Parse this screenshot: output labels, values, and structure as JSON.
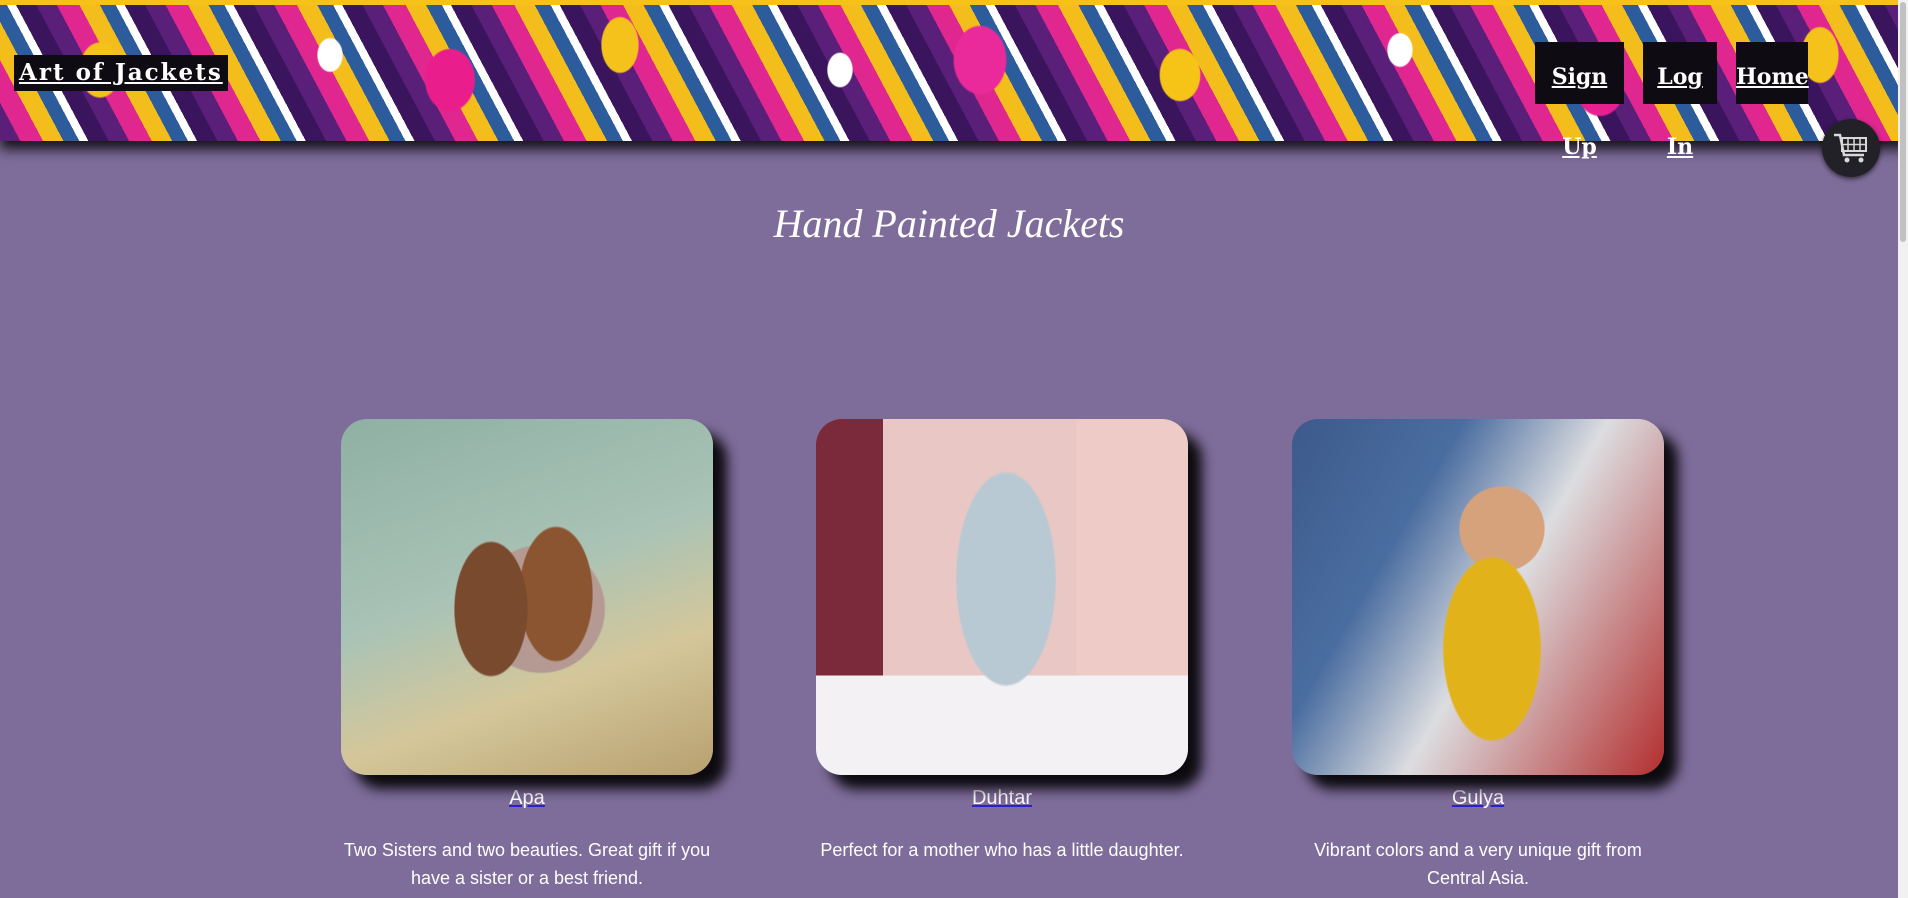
{
  "header": {
    "brand": "Art of Jackets",
    "nav": [
      {
        "label": "Sign Up"
      },
      {
        "label": "Log In"
      },
      {
        "label": "Home"
      }
    ],
    "cart_icon": "shopping-cart-icon"
  },
  "main": {
    "title": "Hand Painted Jackets",
    "products": [
      {
        "name": "Apa",
        "description": "Two Sisters and two beauties. Great gift if you have a sister or a best friend."
      },
      {
        "name": "Duhtar",
        "description": "Perfect for a mother who has a little daughter."
      },
      {
        "name": "Gulya",
        "description": "Vibrant colors and a very unique gift from Central Asia."
      }
    ]
  },
  "colors": {
    "background": "#7e6c9a",
    "nav_background": "#0f0b12",
    "text": "#ffffff",
    "link_underline": "#2a22c8"
  }
}
